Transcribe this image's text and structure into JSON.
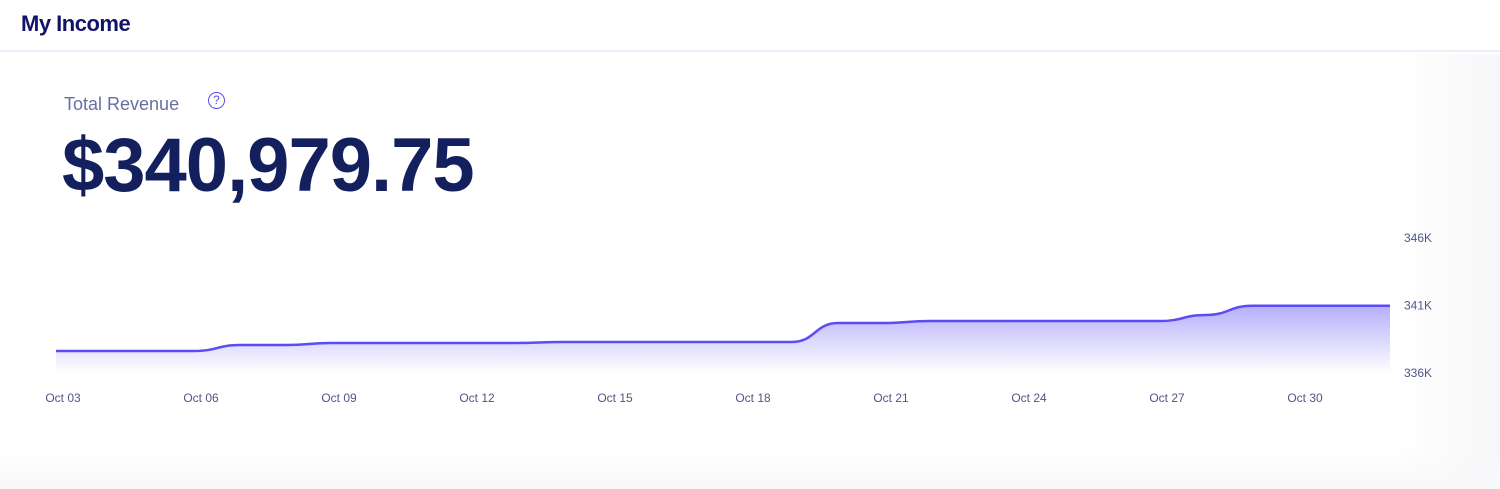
{
  "header": {
    "title": "My Income"
  },
  "summary": {
    "label": "Total Revenue",
    "help_icon": "question-circle-icon",
    "help_glyph": "?",
    "amount": "$340,979.75"
  },
  "colors": {
    "line": "#5b4cf5",
    "title": "#12126b",
    "amount": "#14205e"
  },
  "chart_data": {
    "type": "area",
    "title": "Total Revenue",
    "x": [
      "Oct 03",
      "Oct 04",
      "Oct 05",
      "Oct 06",
      "Oct 07",
      "Oct 08",
      "Oct 09",
      "Oct 10",
      "Oct 11",
      "Oct 12",
      "Oct 13",
      "Oct 14",
      "Oct 15",
      "Oct 16",
      "Oct 17",
      "Oct 18",
      "Oct 19",
      "Oct 20",
      "Oct 21",
      "Oct 22",
      "Oct 23",
      "Oct 24",
      "Oct 25",
      "Oct 26",
      "Oct 27",
      "Oct 28",
      "Oct 29",
      "Oct 30",
      "Oct 31",
      "Nov 01"
    ],
    "values": [
      337630,
      337630,
      337630,
      337630,
      338070,
      338070,
      338220,
      338220,
      338220,
      338220,
      338220,
      338300,
      338300,
      338300,
      338300,
      338300,
      338300,
      339700,
      339700,
      339850,
      339850,
      339850,
      339850,
      339850,
      339850,
      340300,
      340980,
      340980,
      340980,
      340980
    ],
    "x_tick_labels": [
      "Oct 03",
      "Oct 06",
      "Oct 09",
      "Oct 12",
      "Oct 15",
      "Oct 18",
      "Oct 21",
      "Oct 24",
      "Oct 27",
      "Oct 30"
    ],
    "y_tick_labels": [
      "346K",
      "341K",
      "336K"
    ],
    "y_ticks": [
      346000,
      341000,
      336000
    ],
    "ylim": [
      336000,
      346000
    ],
    "y_axis_position": "right",
    "grid": false,
    "legend": "none"
  }
}
